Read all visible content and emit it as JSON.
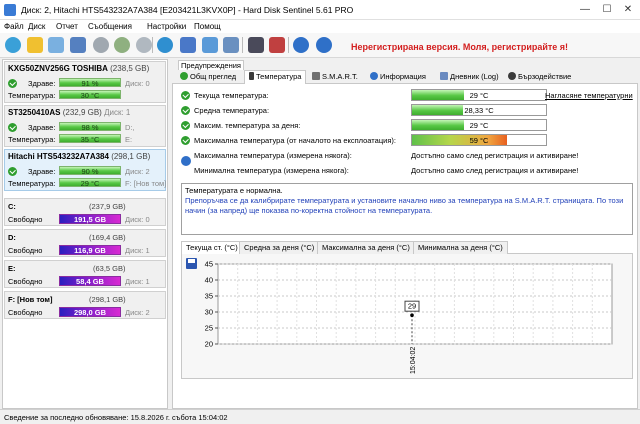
{
  "window": {
    "title": "Диск: 2, Hitachi HTS543232A7A384 [E203421L3KVX0P]  -  Hard Disk Sentinel 5.61 PRO",
    "minimize": "—",
    "maximize": "☐",
    "close": "✕"
  },
  "menu": {
    "items": [
      "Файл",
      "Диск",
      "Отчет",
      "Съобщения",
      "Настройки",
      "Помощ"
    ]
  },
  "toolbar": {
    "unregistered": "Нерегистрирана версия. Моля, регистрирайте я!"
  },
  "disks": [
    {
      "name": "KXG50ZNV256G TOSHIBA",
      "size": "(238,5 GB)",
      "health_label": "Здраве:",
      "health_value": "91 %",
      "health_pct": 91,
      "temp_label": "Температура:",
      "temp_value": "30 °C",
      "disk_no": "Диск: 0",
      "volumes": ""
    },
    {
      "name": "ST3250410AS",
      "size": "(232,9 GB)",
      "disk_no": "Диск: 1",
      "health_label": "Здраве:",
      "health_value": "98 %",
      "health_pct": 98,
      "temp_label": "Температура:",
      "temp_value": "35 °C",
      "volumes_1": "D:,",
      "volumes_2": "E:"
    },
    {
      "name": "Hitachi HTS543232A7A384",
      "size": "(298,1 GB)",
      "health_label": "Здраве:",
      "health_value": "90 %",
      "health_pct": 90,
      "disk_no": "Диск: 2",
      "temp_label": "Температура:",
      "temp_value": "29 °C",
      "volumes_1": "F: [Нов том]"
    }
  ],
  "volumes": [
    {
      "letter": "C:",
      "size": "(237,9 GB)",
      "free_label": "Свободно",
      "free_value": "191,5 GB",
      "free_pct": 80,
      "disk": "Диск: 0"
    },
    {
      "letter": "D:",
      "size": "(169,4 GB)",
      "free_label": "Свободно",
      "free_value": "116,9 GB",
      "free_pct": 69,
      "disk": "Диск: 1"
    },
    {
      "letter": "E:",
      "size": "(63,5 GB)",
      "free_label": "Свободно",
      "free_value": "58,4 GB",
      "free_pct": 92,
      "disk": "Диск: 1"
    },
    {
      "letter": "F: [Нов том]",
      "size": "(298,1 GB)",
      "free_label": "Свободно",
      "free_value": "298,0 GB",
      "free_pct": 100,
      "disk": "Диск: 2"
    }
  ],
  "tabs": {
    "warnings": "Предупреждения",
    "overview": "Общ преглед",
    "temperature": "Температура",
    "smart": "S.M.A.R.T.",
    "information": "Информация",
    "log": "Дневник (Log)",
    "performance": "Бързодействие"
  },
  "temperature": {
    "rows": [
      {
        "label": "Текуща температура:",
        "value": "29 °C",
        "fill_pct": 39,
        "style": "green"
      },
      {
        "label": "Средна температура:",
        "value": "28,33 °C",
        "fill_pct": 38,
        "style": "green"
      },
      {
        "label": "Максим. температура за деня:",
        "value": "29 °C",
        "fill_pct": 39,
        "style": "green"
      },
      {
        "label": "Максимална температура (от началото на експлоатация):",
        "value": "59 °C",
        "fill_pct": 71,
        "style": "orange"
      },
      {
        "label": "Максимална температура (измерена някога):",
        "note": "Достъпно само след регистрация и активиране!"
      },
      {
        "label": "Минимална температура (измерена някога):",
        "note": "Достъпно само след регистрация и активиране!"
      }
    ],
    "calibration_link": "Нагласяне температурни",
    "status_ok": "Температурата е нормална.",
    "calibration_hint": "Препоръчва се да калибрирате температурата и установите начално ниво за температура на S.M.A.R.T. страницата. По този начин (за напред) ще показва по-коректна стойност на температурата."
  },
  "chart_tabs": [
    "Текуща ст. (°C)",
    "Средна за деня (°C)",
    "Максимална за деня (°C)",
    "Минимална за деня (°C)"
  ],
  "chart_data": {
    "type": "line",
    "x": [
      "15:04:02"
    ],
    "series": [
      {
        "values": [
          29
        ]
      }
    ],
    "data_labels": [
      "29"
    ],
    "yticks": [
      "45",
      "40",
      "35",
      "30",
      "25",
      "20"
    ],
    "ylim": [
      20,
      45
    ],
    "grid": true,
    "title": "",
    "xlabel": "",
    "ylabel": ""
  },
  "status": {
    "text": "Сведение за последно обновяване: 15.8.2026 г. събота 15:04:02"
  }
}
